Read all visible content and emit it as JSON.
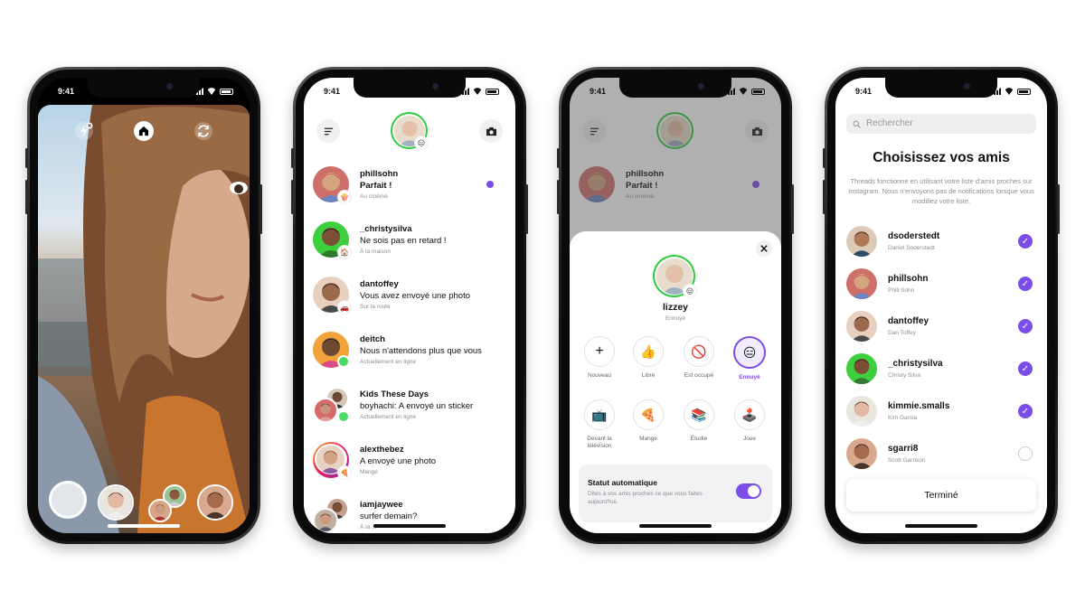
{
  "status_time": "9:41",
  "colors": {
    "accent": "#7b4de8",
    "online": "#4cd964",
    "ring_green": "#2ecc40"
  },
  "camera": {
    "controls": [
      "flash-off-icon",
      "home-icon",
      "switch-camera-icon"
    ]
  },
  "threads": {
    "items": [
      {
        "name": "phillsohn",
        "message": "Parfait !",
        "status": "Au cinéma",
        "unread": true,
        "badge": "🍿"
      },
      {
        "name": "_christysilva",
        "message": "Ne sois pas en retard !",
        "status": "À la maison",
        "badge": "🏠"
      },
      {
        "name": "dantoffey",
        "message": "Vous avez envoyé une photo",
        "status": "Sur la route",
        "badge": "🚗"
      },
      {
        "name": "deitch",
        "message": "Nous n'attendons plus que vous",
        "status": "Actuellement en ligne"
      },
      {
        "name": "Kids These Days",
        "message": "boyhachi: A envoyé un sticker",
        "status": "Actuellement en ligne"
      },
      {
        "name": "alexthebez",
        "message": "A envoyé une photo",
        "status": "Mangé",
        "badge": "🍕"
      },
      {
        "name": "iamjaywee",
        "message": "surfer demain?",
        "status": "À la ..."
      }
    ]
  },
  "status_sheet": {
    "username": "lizzey",
    "current_status": "Ennuyé",
    "options_row1": [
      {
        "label": "Nouveau",
        "icon": "+"
      },
      {
        "label": "Libre",
        "icon": "👍"
      },
      {
        "label": "Est occupé",
        "icon": "🚫"
      },
      {
        "label": "Ennuyé",
        "icon": "😑"
      }
    ],
    "options_row2": [
      {
        "label": "Devant la télévision",
        "icon": "📺"
      },
      {
        "label": "Mange",
        "icon": "🍕"
      },
      {
        "label": "Étudie",
        "icon": "📚"
      },
      {
        "label": "Joue",
        "icon": "🕹️"
      }
    ],
    "auto_title": "Statut automatique",
    "auto_desc": "Dites à vos amis proches ce que vous faites aujourd'hui.",
    "auto_enabled": true
  },
  "friends": {
    "search_placeholder": "Rechercher",
    "title": "Choisissez vos amis",
    "description": "Threads fonctionne en utilisant votre liste d'amis proches sur Instagram. Nous n'envoyons pas de notifications lorsque vous modifiez votre liste.",
    "list": [
      {
        "username": "dsoderstedt",
        "full_name": "Daniel Soderstedt",
        "selected": true
      },
      {
        "username": "phillsohn",
        "full_name": "Phill Sohn",
        "selected": true
      },
      {
        "username": "dantoffey",
        "full_name": "Dan Toffey",
        "selected": true
      },
      {
        "username": "_christysilva",
        "full_name": "Christy Silva",
        "selected": true
      },
      {
        "username": "kimmie.smalls",
        "full_name": "Kim Garcia",
        "selected": true
      },
      {
        "username": "sgarri8",
        "full_name": "Scott Garrison",
        "selected": false
      }
    ],
    "done_label": "Terminé"
  }
}
